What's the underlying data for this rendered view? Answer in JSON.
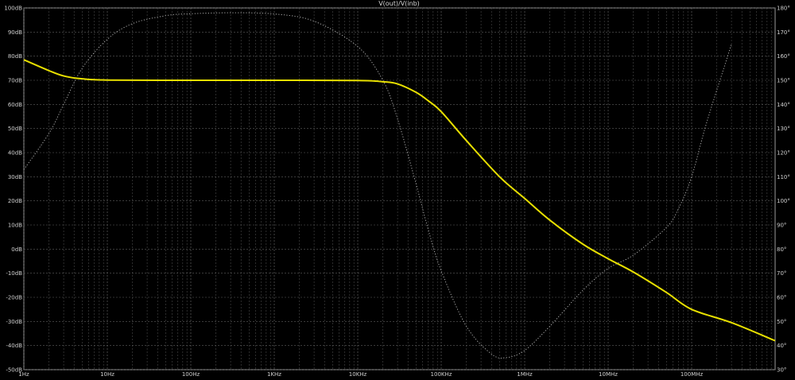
{
  "chart_data": {
    "type": "line",
    "title": "V(out)/V(inb)",
    "x_scale": "log",
    "xlim": [
      1,
      1000000000
    ],
    "x_ticks": [
      {
        "value": 1,
        "label": "1Hz"
      },
      {
        "value": 10,
        "label": "10Hz"
      },
      {
        "value": 100,
        "label": "100Hz"
      },
      {
        "value": 1000,
        "label": "1KHz"
      },
      {
        "value": 10000,
        "label": "10KHz"
      },
      {
        "value": 100000,
        "label": "100KHz"
      },
      {
        "value": 1000000,
        "label": "1MHz"
      },
      {
        "value": 10000000,
        "label": "10MHz"
      },
      {
        "value": 100000000,
        "label": "100MHz"
      }
    ],
    "y_left": {
      "ylim": [
        -50,
        100
      ],
      "ticks": [
        {
          "value": 100,
          "label": "100dB"
        },
        {
          "value": 90,
          "label": "90dB"
        },
        {
          "value": 80,
          "label": "80dB"
        },
        {
          "value": 70,
          "label": "70dB"
        },
        {
          "value": 60,
          "label": "60dB"
        },
        {
          "value": 50,
          "label": "50dB"
        },
        {
          "value": 40,
          "label": "40dB"
        },
        {
          "value": 30,
          "label": "30dB"
        },
        {
          "value": 20,
          "label": "20dB"
        },
        {
          "value": 10,
          "label": "10dB"
        },
        {
          "value": 0,
          "label": "0dB"
        },
        {
          "value": -10,
          "label": "-10dB"
        },
        {
          "value": -20,
          "label": "-20dB"
        },
        {
          "value": -30,
          "label": "-30dB"
        },
        {
          "value": -40,
          "label": "-40dB"
        },
        {
          "value": -50,
          "label": "-50dB"
        }
      ]
    },
    "y_right": {
      "ylim": [
        30,
        180
      ],
      "ticks": [
        {
          "value": 180,
          "label": "180°"
        },
        {
          "value": 170,
          "label": "170°"
        },
        {
          "value": 160,
          "label": "160°"
        },
        {
          "value": 150,
          "label": "150°"
        },
        {
          "value": 140,
          "label": "140°"
        },
        {
          "value": 130,
          "label": "130°"
        },
        {
          "value": 120,
          "label": "120°"
        },
        {
          "value": 110,
          "label": "110°"
        },
        {
          "value": 100,
          "label": "100°"
        },
        {
          "value": 90,
          "label": "90°"
        },
        {
          "value": 80,
          "label": "80°"
        },
        {
          "value": 70,
          "label": "70°"
        },
        {
          "value": 60,
          "label": "60°"
        },
        {
          "value": 50,
          "label": "50°"
        },
        {
          "value": 40,
          "label": "40°"
        },
        {
          "value": 30,
          "label": "30°"
        }
      ]
    },
    "grid": true,
    "series": [
      {
        "axis": "left",
        "style": "solid",
        "color": "#e8e000",
        "points": [
          [
            1,
            78.5
          ],
          [
            2,
            74
          ],
          [
            3,
            71.8
          ],
          [
            5,
            70.6
          ],
          [
            10,
            70.1
          ],
          [
            100,
            70.0
          ],
          [
            1000,
            70.0
          ],
          [
            10000,
            69.9
          ],
          [
            20000,
            69.4
          ],
          [
            30000,
            68.5
          ],
          [
            50000,
            65
          ],
          [
            70000,
            61.5
          ],
          [
            100000,
            57
          ],
          [
            200000,
            45
          ],
          [
            500000,
            30
          ],
          [
            1000000,
            21
          ],
          [
            2000000,
            12
          ],
          [
            5000000,
            2
          ],
          [
            10000000,
            -4
          ],
          [
            20000000,
            -9.5
          ],
          [
            50000000,
            -18
          ],
          [
            100000000,
            -25
          ],
          [
            300000000,
            -30.5
          ],
          [
            1000000000,
            -38
          ]
        ]
      },
      {
        "axis": "right",
        "style": "dotted",
        "color": "#bdbdbd",
        "points": [
          [
            1,
            113
          ],
          [
            2,
            128
          ],
          [
            3,
            140
          ],
          [
            5,
            155
          ],
          [
            10,
            167
          ],
          [
            20,
            173.5
          ],
          [
            50,
            176.8
          ],
          [
            100,
            177.6
          ],
          [
            300,
            178
          ],
          [
            1000,
            177.5
          ],
          [
            3000,
            174.5
          ],
          [
            10000,
            164
          ],
          [
            20000,
            150
          ],
          [
            30000,
            134
          ],
          [
            50000,
            107
          ],
          [
            70000,
            88
          ],
          [
            100000,
            71
          ],
          [
            200000,
            48
          ],
          [
            400000,
            36.5
          ],
          [
            600000,
            35
          ],
          [
            1000000,
            38
          ],
          [
            2000000,
            48
          ],
          [
            5000000,
            63
          ],
          [
            10000000,
            72
          ],
          [
            20000000,
            77.5
          ],
          [
            50000000,
            89
          ],
          [
            70000000,
            97
          ],
          [
            100000000,
            110
          ],
          [
            150000000,
            132
          ],
          [
            300000000,
            165
          ]
        ]
      }
    ]
  }
}
